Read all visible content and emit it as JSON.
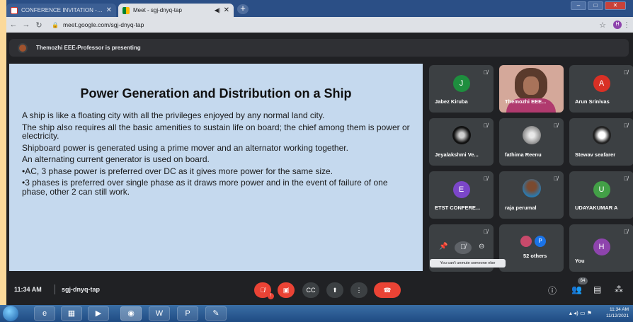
{
  "browser": {
    "tabs": [
      {
        "label": "CONFERENCE INVITATION - REG",
        "close": "✕"
      },
      {
        "label": "Meet - sgj-dnyq-tap",
        "close": "✕",
        "audio": "◀)"
      }
    ],
    "new_tab": "+",
    "url": "meet.google.com/sgj-dnyq-tap",
    "profile_initial": "H"
  },
  "meet": {
    "presenting_text": "Themozhi EEE-Professor is presenting",
    "slide": {
      "title": "Power Generation and Distribution on a Ship",
      "paragraphs": [
        "A ship is like a floating city with all the privileges enjoyed by any normal land city.",
        "The ship also requires all the basic amenities to sustain life on board; the chief among them is power or electricity.",
        "Shipboard power is generated using a prime mover and an alternator working together.",
        "An alternating current generator is used on board.",
        "•AC, 3 phase power is preferred over DC as it gives more power for the  same size.",
        "•3 phases is preferred over single phase as it draws more power and in the event of failure of one phase, other 2 can still work."
      ]
    },
    "participants": [
      {
        "name": "Jabez Kiruba",
        "initial": "J",
        "color": "#1e8e3e"
      },
      {
        "name": "Themozhi EEE...",
        "initial": "",
        "color": ""
      },
      {
        "name": "Arun Srinivas",
        "initial": "A",
        "color": "#d93025"
      },
      {
        "name": "Jeyalakshmi Ve...",
        "initial": "",
        "color": "#111111"
      },
      {
        "name": "fathima Reenu",
        "initial": "",
        "color": "#9a9a9a"
      },
      {
        "name": "Stewav seafarer",
        "initial": "",
        "color": "#2a2a2a"
      },
      {
        "name": "ETST CONFERE...",
        "initial": "E",
        "color": "#7b46c9"
      },
      {
        "name": "raja perumal",
        "initial": "",
        "color": "#2a7ab0"
      },
      {
        "name": "UDAYAKUMAR A",
        "initial": "U",
        "color": "#43a047"
      },
      {
        "name": "52 others",
        "initial": "P",
        "color": "#1a73e8"
      },
      {
        "name": "You",
        "initial": "H",
        "color": "#8e44ad"
      }
    ],
    "tooltip": "You can't unmute someone else",
    "time": "11:34 AM",
    "separator": "|",
    "meeting_code": "sgj-dnyq-tap",
    "mic_badge": "!",
    "participant_count": "64"
  },
  "taskbar": {
    "time": "11:34 AM",
    "date": "11/12/2021"
  }
}
